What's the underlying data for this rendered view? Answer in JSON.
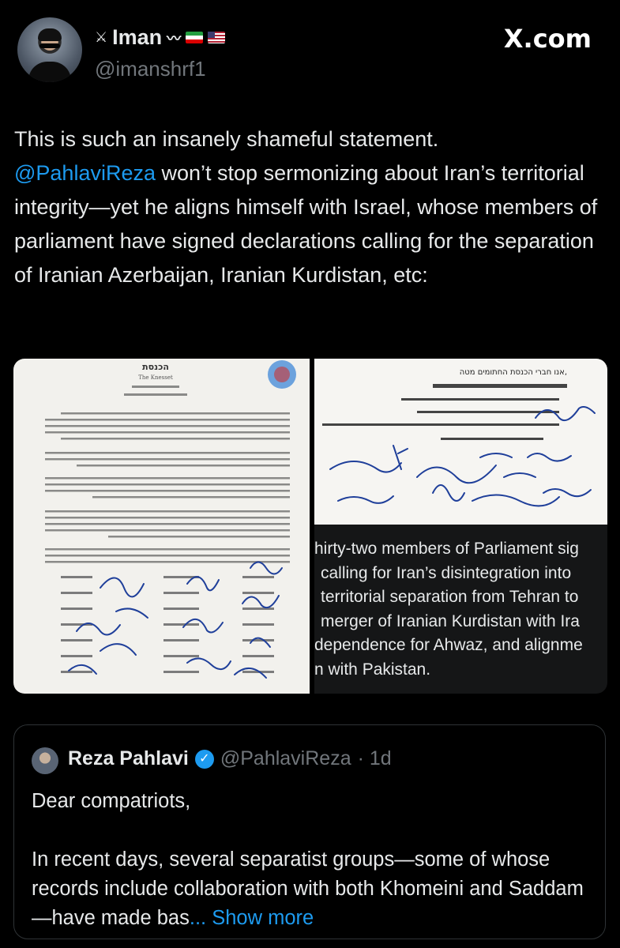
{
  "author": {
    "name": "Iman",
    "handle": "@imanshrf1",
    "flags": [
      "iran-flag",
      "usa-flag"
    ],
    "decorations": [
      "lion-sword-emblem",
      "winged-emblem"
    ]
  },
  "brand": "X.com",
  "tweet": {
    "text_before_mention": "This is such an insanely shameful statement.",
    "mention": "@PahlaviReza",
    "text_after_mention": " won’t stop sermonizing about Iran’s territorial integrity—yet he aligns himself with Israel, whose members of parliament have signed declarations calling for the separation of Iranian Azerbaijan, Iranian Kurdistan, etc:"
  },
  "media": {
    "left_doc": {
      "header_title": "הכנסת",
      "header_subtitle": "The Knesset"
    },
    "right_doc": {
      "line1": "אנו חברי הכנסת החתומים מטה,"
    },
    "caption_lines": [
      "hirty-two members of Parliament sig",
      "calling for Iran’s disintegration into",
      "territorial separation from Tehran to",
      "merger of Iranian Kurdistan with Ira",
      "dependence for Ahwaz, and alignme",
      "n with Pakistan."
    ]
  },
  "quote": {
    "name": "Reza Pahlavi",
    "handle": "@PahlaviReza",
    "time": "· 1d",
    "greeting": "Dear compatriots,",
    "body": "In recent days, several separatist groups—some of whose records include collaboration with both Khomeini and Saddam—have made bas",
    "ellipsis": "...",
    "show_more": "Show more"
  },
  "colors": {
    "background": "#000000",
    "text": "#e7e9ea",
    "muted": "#71767b",
    "accent": "#1d9bf0",
    "border": "#2f3336"
  }
}
